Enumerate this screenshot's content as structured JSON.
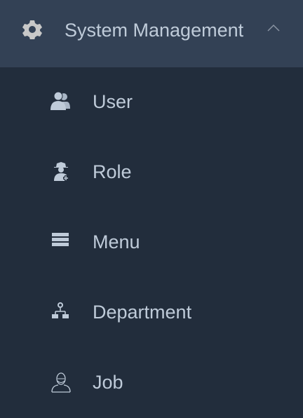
{
  "header": {
    "title": "System Management",
    "icon": "gear-icon",
    "expanded": true
  },
  "items": [
    {
      "label": "User",
      "icon": "users-icon"
    },
    {
      "label": "Role",
      "icon": "role-spy-icon"
    },
    {
      "label": "Menu",
      "icon": "menu-bars-icon"
    },
    {
      "label": "Department",
      "icon": "org-chart-icon"
    },
    {
      "label": "Job",
      "icon": "person-icon"
    }
  ],
  "colors": {
    "header_bg": "#334155",
    "menu_bg": "#222d3c",
    "text": "#bfcbd9"
  }
}
